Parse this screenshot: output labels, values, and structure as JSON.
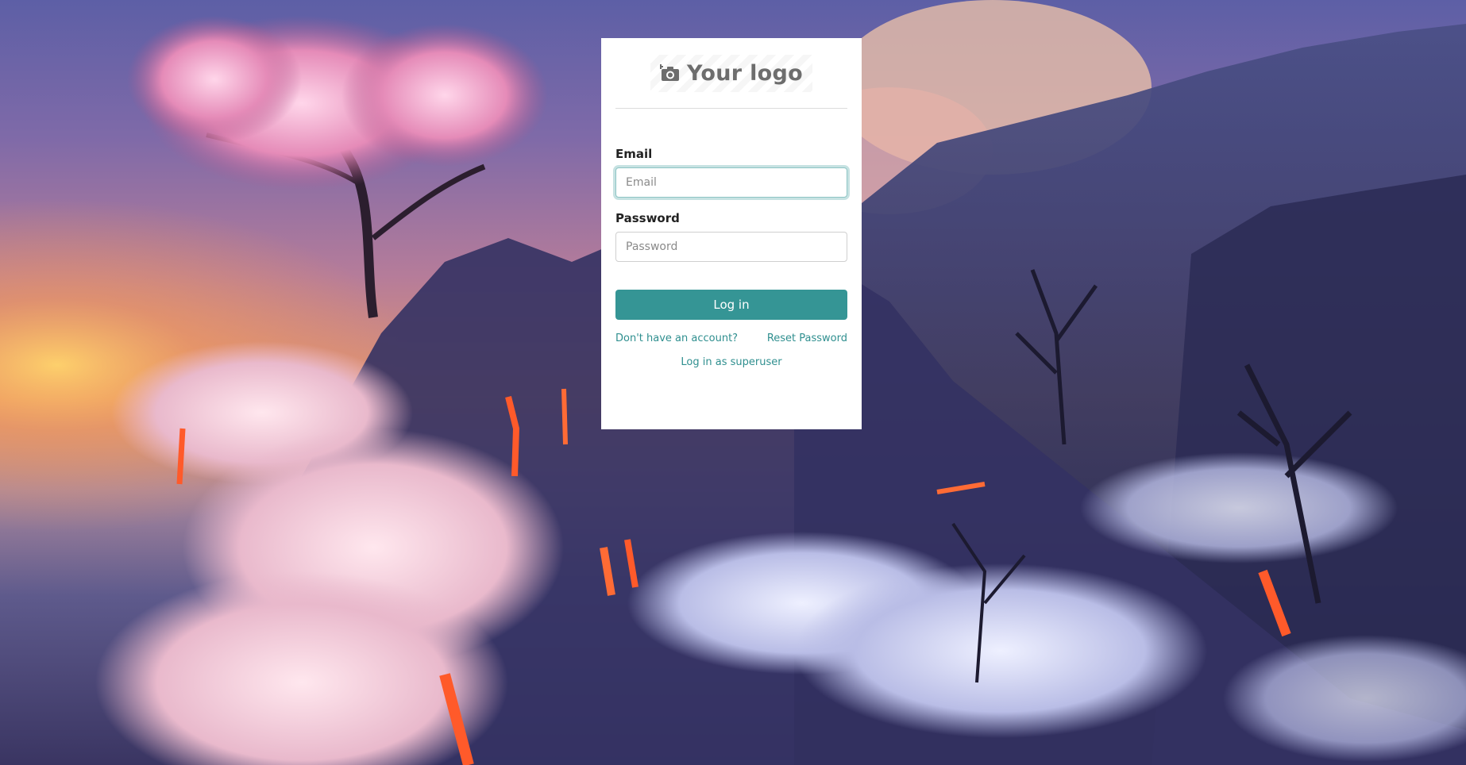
{
  "logo": {
    "text": "Your logo",
    "icon": "camera-icon"
  },
  "form": {
    "email_label": "Email",
    "email_placeholder": "Email",
    "email_value": "",
    "password_label": "Password",
    "password_placeholder": "Password",
    "password_value": "",
    "login_label": "Log in"
  },
  "links": {
    "signup": "Don't have an account?",
    "reset": "Reset Password",
    "superuser": "Log in as superuser"
  },
  "colors": {
    "accent": "#359595",
    "link": "#2f8f8f",
    "card": "#ffffff"
  }
}
